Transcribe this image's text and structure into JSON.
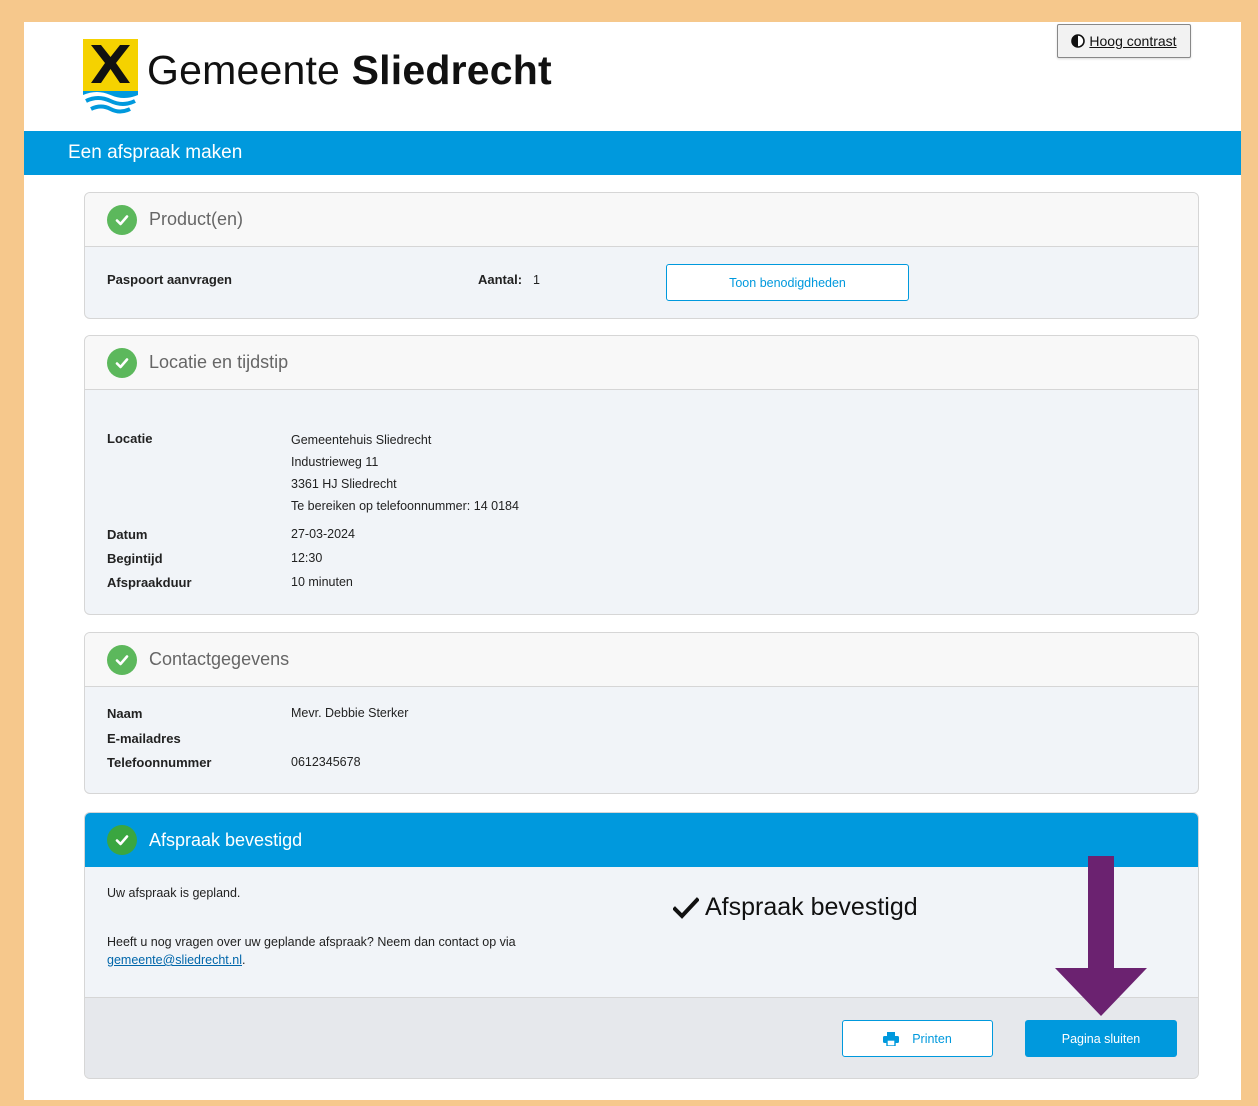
{
  "header": {
    "brand_prefix": "Gemeente",
    "brand_name": "Sliedrecht",
    "contrast_label": "Hoog contrast"
  },
  "title_bar": "Een afspraak maken",
  "products": {
    "heading": "Product(en)",
    "name": "Paspoort aanvragen",
    "amount_label": "Aantal:",
    "amount_value": "1",
    "requirements_button": "Toon benodigdheden"
  },
  "location": {
    "heading": "Locatie en tijdstip",
    "location_label": "Locatie",
    "location_lines": [
      "Gemeentehuis Sliedrecht",
      "Industrieweg 11",
      "3361 HJ Sliedrecht",
      "Te bereiken op telefoonnummer: 14 0184"
    ],
    "date_label": "Datum",
    "date_value": "27-03-2024",
    "start_label": "Begintijd",
    "start_value": "12:30",
    "duration_label": "Afspraakduur",
    "duration_value": "10 minuten"
  },
  "contact": {
    "heading": "Contactgegevens",
    "name_label": "Naam",
    "name_value": "Mevr. Debbie Sterker",
    "email_label": "E-mailadres",
    "phone_label": "Telefoonnummer",
    "phone_value": "0612345678"
  },
  "confirmation": {
    "heading": "Afspraak bevestigd",
    "planned_text": "Uw afspraak is gepland.",
    "questions_text": "Heeft u nog vragen over uw geplande afspraak? Neem dan contact op via",
    "email_link": "gemeente@sliedrecht.nl",
    "trailing_period": ".",
    "annotation_text": "Afspraak bevestigd",
    "print_button": "Printen",
    "close_button": "Pagina sluiten"
  },
  "colors": {
    "brand_blue": "#0099dd",
    "check_green": "#5cb85c",
    "arrow_purple": "#6b2270",
    "frame_orange": "#f6c88c"
  }
}
